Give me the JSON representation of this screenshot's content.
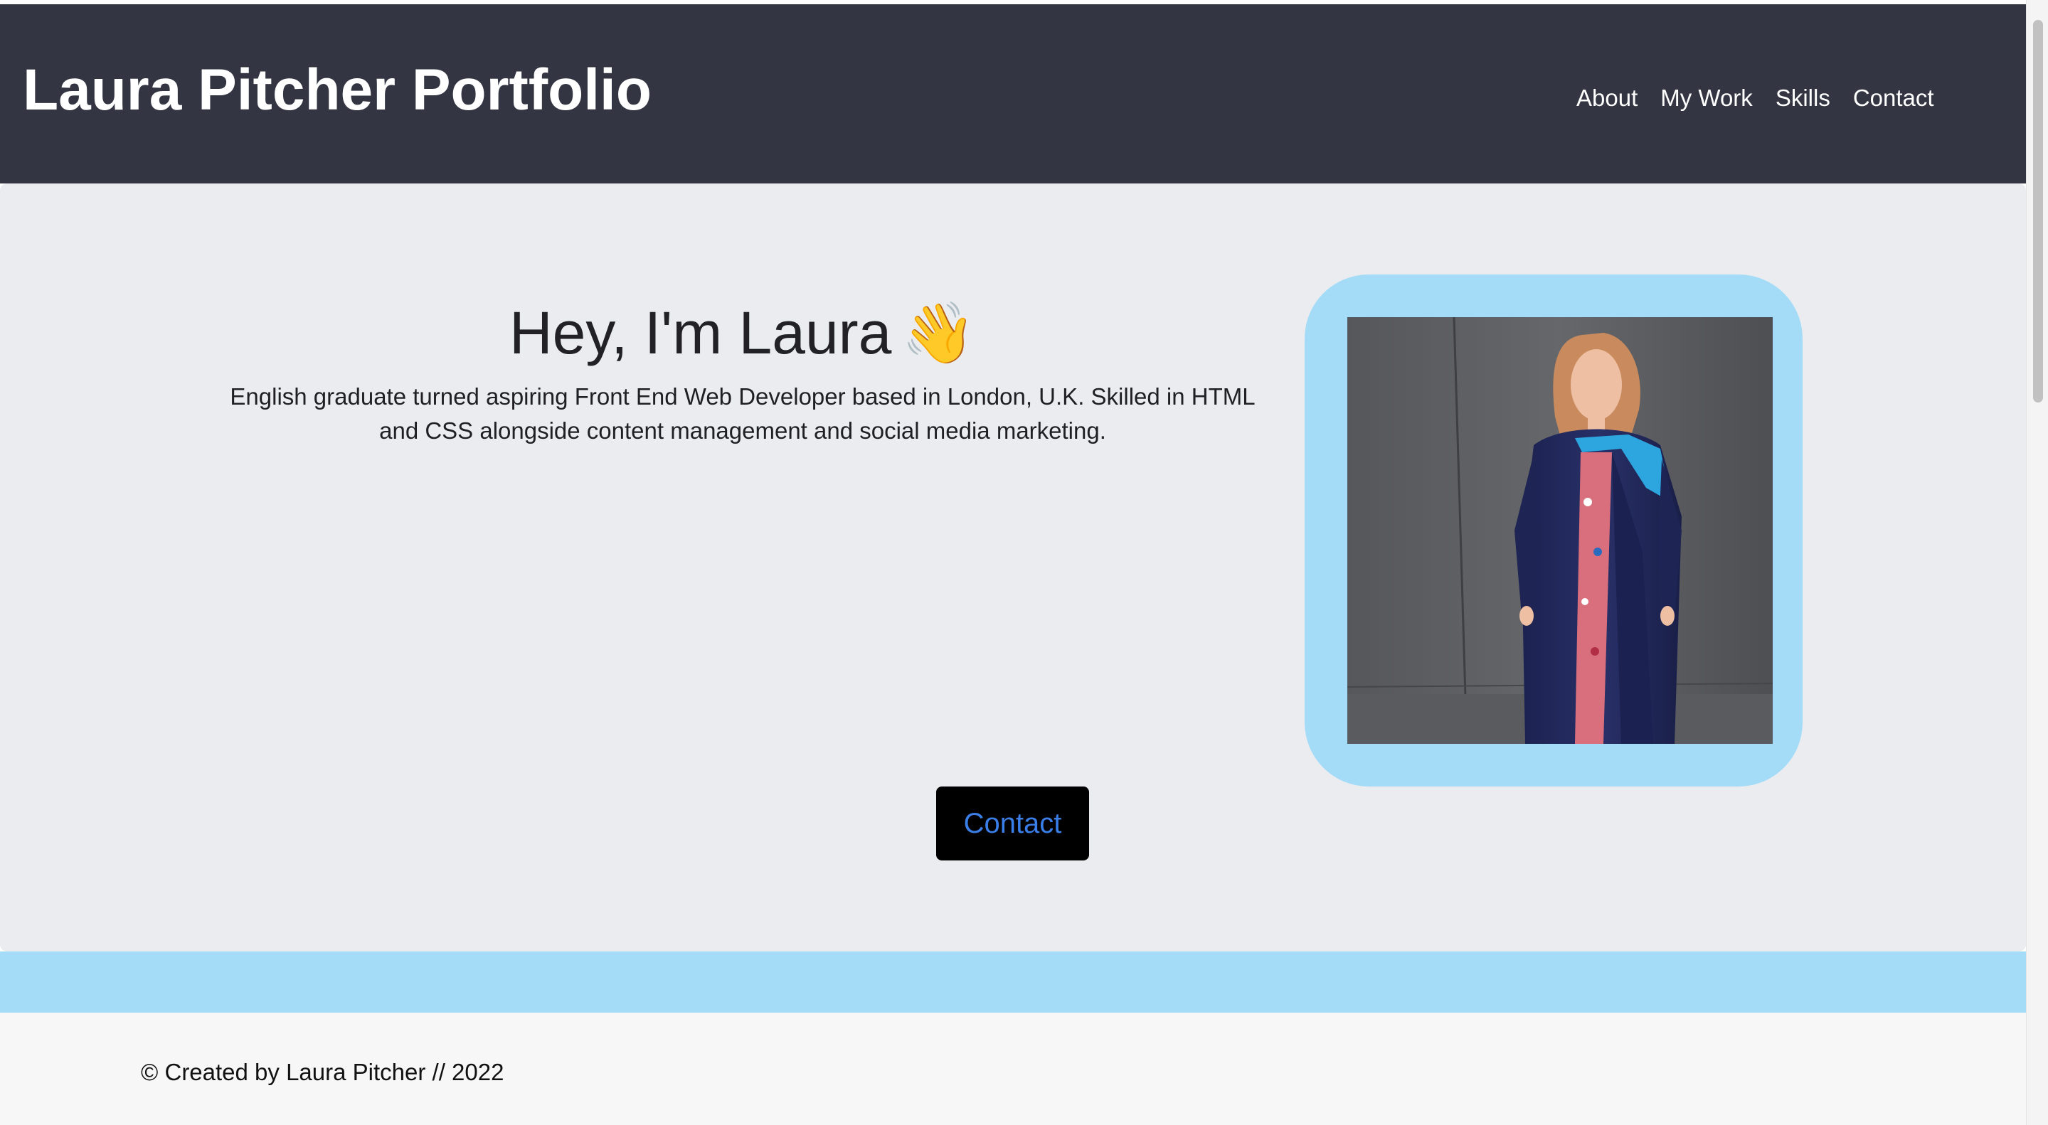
{
  "header": {
    "title": "Laura Pitcher Portfolio",
    "nav": [
      {
        "label": "About"
      },
      {
        "label": "My Work"
      },
      {
        "label": "Skills"
      },
      {
        "label": "Contact"
      }
    ]
  },
  "hero": {
    "heading": "Hey, I'm Laura",
    "heading_icon": "waving-hand-icon",
    "wave_emoji": "👋",
    "intro": "English graduate turned aspiring Front End Web Developer based in London, U.K. Skilled in HTML and CSS alongside content management and social media marketing.",
    "contact_label": "Contact",
    "photo_subject": "graduate-photo"
  },
  "footer": {
    "text": "© Created by Laura Pitcher // 2022"
  },
  "colors": {
    "header_bg": "#333542",
    "hero_bg": "#ebecf0",
    "accent_blue": "#a4dcf8",
    "button_bg": "#000000",
    "button_text": "#3a7ee8"
  }
}
